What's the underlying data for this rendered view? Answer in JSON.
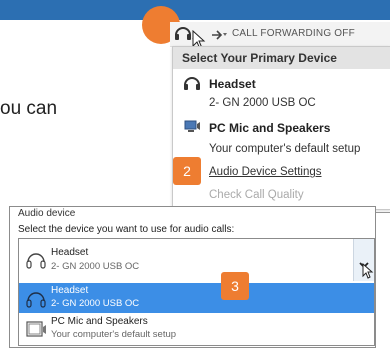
{
  "background": {
    "partial_text": "ou can"
  },
  "toolbar": {
    "call_forwarding_label": "CALL FORWARDING OFF"
  },
  "menu": {
    "header": "Select Your Primary Device",
    "headset_title": "Headset",
    "headset_sub": "2- GN 2000 USB OC",
    "pc_title": "PC Mic and Speakers",
    "pc_sub": "Your computer's default setup",
    "audio_settings": "Audio Device Settings",
    "check_quality": "Check Call Quality"
  },
  "panel": {
    "legend": "Audio device",
    "prompt": "Select the device you want to use for audio calls:",
    "dropdown": {
      "title": "Headset",
      "sub": "2- GN 2000 USB OC"
    },
    "options": [
      {
        "title": "Headset",
        "sub": "2- GN 2000 USB OC"
      },
      {
        "title": "PC Mic and Speakers",
        "sub": "Your computer's default setup"
      }
    ]
  },
  "steps": {
    "two": "2",
    "three": "3"
  },
  "colors": {
    "accent_orange": "#ee7d31",
    "selection_blue": "#3c8ee6",
    "banner_blue": "#2c6fb2"
  },
  "icons": [
    "headset-icon",
    "phone-forward-icon",
    "pc-speaker-icon",
    "cursor-icon",
    "chevron-down-icon"
  ]
}
